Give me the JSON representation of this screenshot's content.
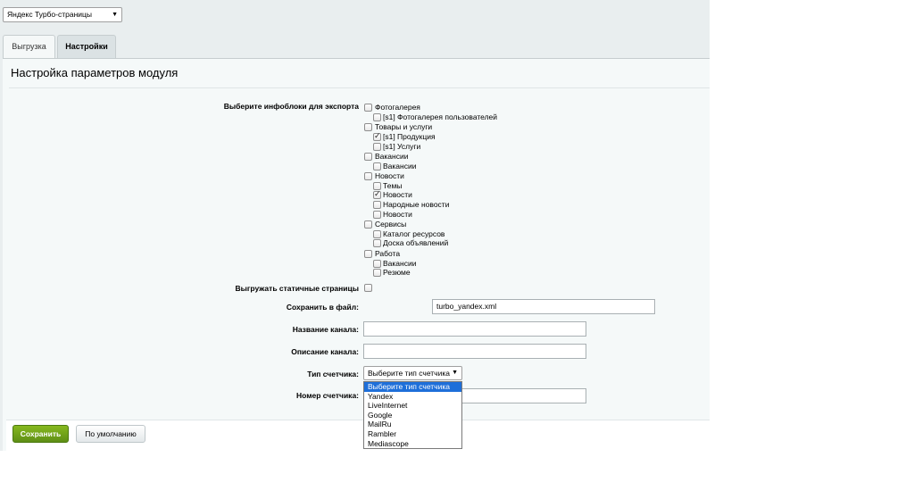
{
  "site_selector": {
    "value": "Яндекс Турбо-страницы"
  },
  "tabs": [
    {
      "label": "Выгрузка",
      "active": false
    },
    {
      "label": "Настройки",
      "active": true
    }
  ],
  "panel": {
    "title": "Настройка параметров модуля"
  },
  "form": {
    "iblocks_label": "Выберите инфоблоки для экспорта",
    "tree": [
      {
        "label": "Фотогалерея",
        "checked": false,
        "children": [
          {
            "label": "[s1] Фотогалерея пользователей",
            "checked": false
          }
        ]
      },
      {
        "label": "Товары и услуги",
        "checked": false,
        "children": [
          {
            "label": "[s1] Продукция",
            "checked": true
          },
          {
            "label": "[s1] Услуги",
            "checked": false
          }
        ]
      },
      {
        "label": "Вакансии",
        "checked": false,
        "children": [
          {
            "label": "Вакансии",
            "checked": false
          }
        ]
      },
      {
        "label": "Новости",
        "checked": false,
        "children": [
          {
            "label": "Темы",
            "checked": false
          },
          {
            "label": "Новости",
            "checked": true
          },
          {
            "label": "Народные новости",
            "checked": false
          },
          {
            "label": "Новости",
            "checked": false
          }
        ]
      },
      {
        "label": "Сервисы",
        "checked": false,
        "children": [
          {
            "label": "Каталог ресурсов",
            "checked": false
          },
          {
            "label": "Доска объявлений",
            "checked": false
          }
        ]
      },
      {
        "label": "Работа",
        "checked": false,
        "children": [
          {
            "label": "Вакансии",
            "checked": false
          },
          {
            "label": "Резюме",
            "checked": false
          }
        ]
      }
    ],
    "static_pages_label": "Выгружать статичные страницы",
    "static_pages_checked": false,
    "save_file_label": "Сохранить в файл:",
    "save_file_value": "turbo_yandex.xml",
    "channel_name_label": "Название канала:",
    "channel_name_value": "",
    "channel_desc_label": "Описание канала:",
    "channel_desc_value": "",
    "counter_type_label": "Тип счетчика:",
    "counter_type_value": "Выберите тип счетчика",
    "counter_type_options": [
      "Выберите тип счетчика",
      "Yandex",
      "LiveInternet",
      "Google",
      "MailRu",
      "Rambler",
      "Mediascope"
    ],
    "counter_number_label": "Номер счетчика:",
    "counter_number_value": ""
  },
  "buttons": {
    "save": "Сохранить",
    "default": "По умолчанию"
  },
  "colors": {
    "save_button": "#6fa11a",
    "dropdown_highlight": "#1e6fd9",
    "page_bg": "#e9eeef"
  }
}
